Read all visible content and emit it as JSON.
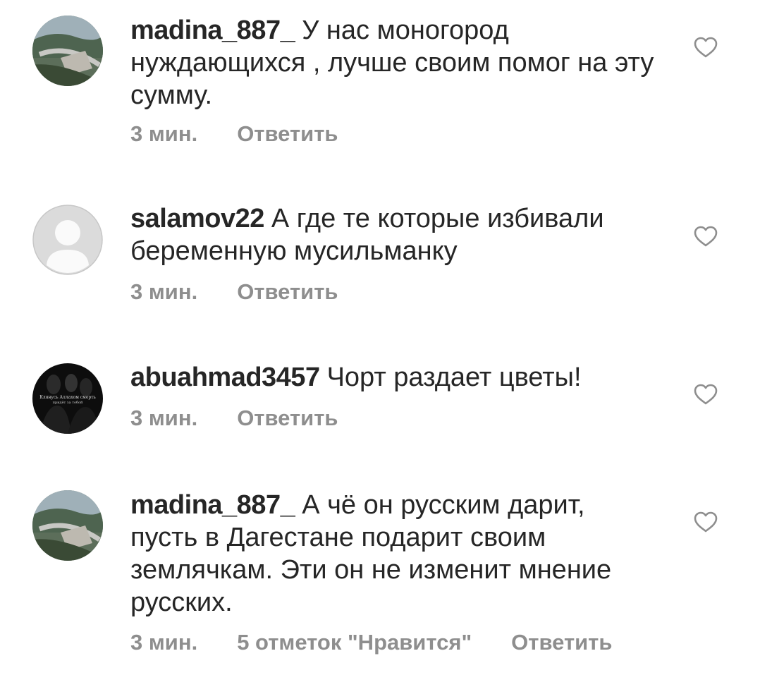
{
  "comments": [
    {
      "username": "madina_887_",
      "text": "У нас моногород нуждающихся , лучше своим помог на эту сумму.",
      "time": "3 мин.",
      "reply": "Ответить",
      "avatar_icon": "mountain-road-photo"
    },
    {
      "username": "salamov22",
      "text": "А где те которые избивали беременную мусильманку",
      "time": "3 мин.",
      "reply": "Ответить",
      "avatar_icon": "default-user-icon"
    },
    {
      "username": "abuahmad3457",
      "text": "Чорт раздает цветы!",
      "time": "3 мин.",
      "reply": "Ответить",
      "avatar_icon": "dark-photo",
      "avatar_caption_1": "Клянусь Аллахом смерть",
      "avatar_caption_2": "придёт за тобой"
    },
    {
      "username": "madina_887_",
      "text": "А чё он русским дарит, пусть в Дагестане подарит своим землячкам. Эти он не изменит мнение русских.",
      "time": "3 мин.",
      "likes": "5 отметок \"Нравится\"",
      "reply": "Ответить",
      "avatar_icon": "mountain-road-photo"
    }
  ],
  "colors": {
    "text": "#262626",
    "secondary": "#8e8e8e",
    "background": "#ffffff"
  }
}
